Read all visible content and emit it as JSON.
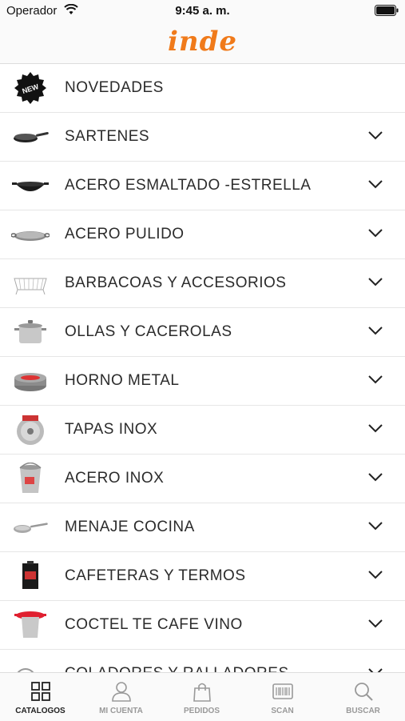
{
  "status_bar": {
    "carrier": "Operador",
    "time": "9:45 a. m."
  },
  "header": {
    "logo_text": "inde",
    "brand_color": "#f07a1a"
  },
  "categories": [
    {
      "label": "NOVEDADES",
      "icon": "new-badge-icon"
    },
    {
      "label": "SARTENES",
      "icon": "frying-pan-icon"
    },
    {
      "label": "ACERO ESMALTADO -ESTRELLA",
      "icon": "wok-icon"
    },
    {
      "label": "ACERO PULIDO",
      "icon": "paella-pan-icon"
    },
    {
      "label": "BARBACOAS Y ACCESORIOS",
      "icon": "grill-rack-icon"
    },
    {
      "label": "OLLAS Y CACEROLAS",
      "icon": "stock-pot-icon"
    },
    {
      "label": "HORNO METAL",
      "icon": "baking-mold-icon"
    },
    {
      "label": "TAPAS INOX",
      "icon": "lid-icon"
    },
    {
      "label": "ACERO INOX",
      "icon": "bucket-icon"
    },
    {
      "label": "MENAJE COCINA",
      "icon": "ladle-icon"
    },
    {
      "label": "CAFETERAS Y TERMOS",
      "icon": "coffee-maker-icon"
    },
    {
      "label": "COCTEL TE CAFE VINO",
      "icon": "tea-strainer-icon"
    },
    {
      "label": "COLADORES Y RALLADORES",
      "icon": "strainer-icon"
    }
  ],
  "tabs": [
    {
      "label": "CATALOGOS",
      "icon": "grid-icon",
      "active": true
    },
    {
      "label": "MI CUENTA",
      "icon": "user-icon",
      "active": false
    },
    {
      "label": "PEDIDOS",
      "icon": "bag-icon",
      "active": false
    },
    {
      "label": "SCAN",
      "icon": "barcode-icon",
      "active": false
    },
    {
      "label": "BUSCAR",
      "icon": "search-icon",
      "active": false
    }
  ]
}
